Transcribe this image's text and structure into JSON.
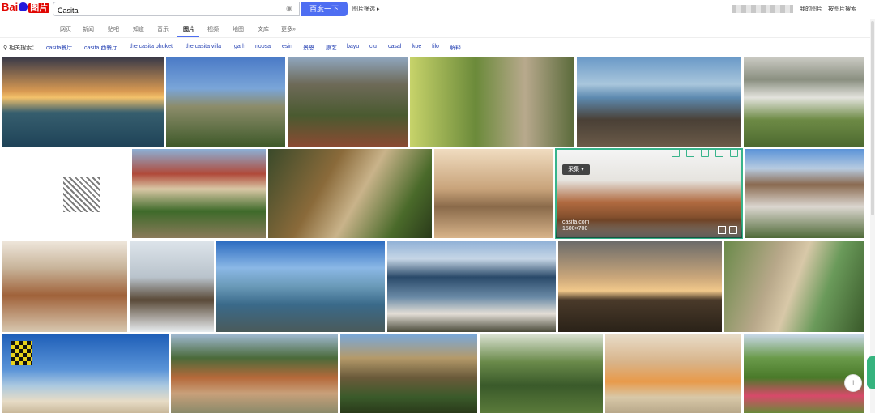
{
  "header": {
    "logo_left": "Bai",
    "logo_right": "图片",
    "search_value": "Casita",
    "search_button": "百度一下",
    "ext_link": "图片筛选 ▸",
    "right_links": [
      "我的图片",
      "按图片搜索"
    ]
  },
  "tabs": [
    "网页",
    "新闻",
    "贴吧",
    "知道",
    "音乐",
    "图片",
    "视频",
    "地图",
    "文库",
    "更多»"
  ],
  "active_tab": "图片",
  "related": {
    "label": "相关搜索：",
    "items": [
      "casita餐厅",
      "casita 西餐厅",
      "the casita phuket",
      "the casita villa",
      "garh",
      "noosa",
      "esin",
      "景恩",
      "康艺",
      "bayu",
      "ciu",
      "casal",
      "koe",
      "filo",
      "解释"
    ]
  },
  "hover": {
    "dropdown_label": "采集 ▾",
    "source": "casita.com",
    "size": "1500×700"
  },
  "float_button": "↑",
  "colors": {
    "accent": "#4e6ef2",
    "link": "#2440b3",
    "logo_red": "#e10602",
    "logo_blue": "#2319dc"
  }
}
